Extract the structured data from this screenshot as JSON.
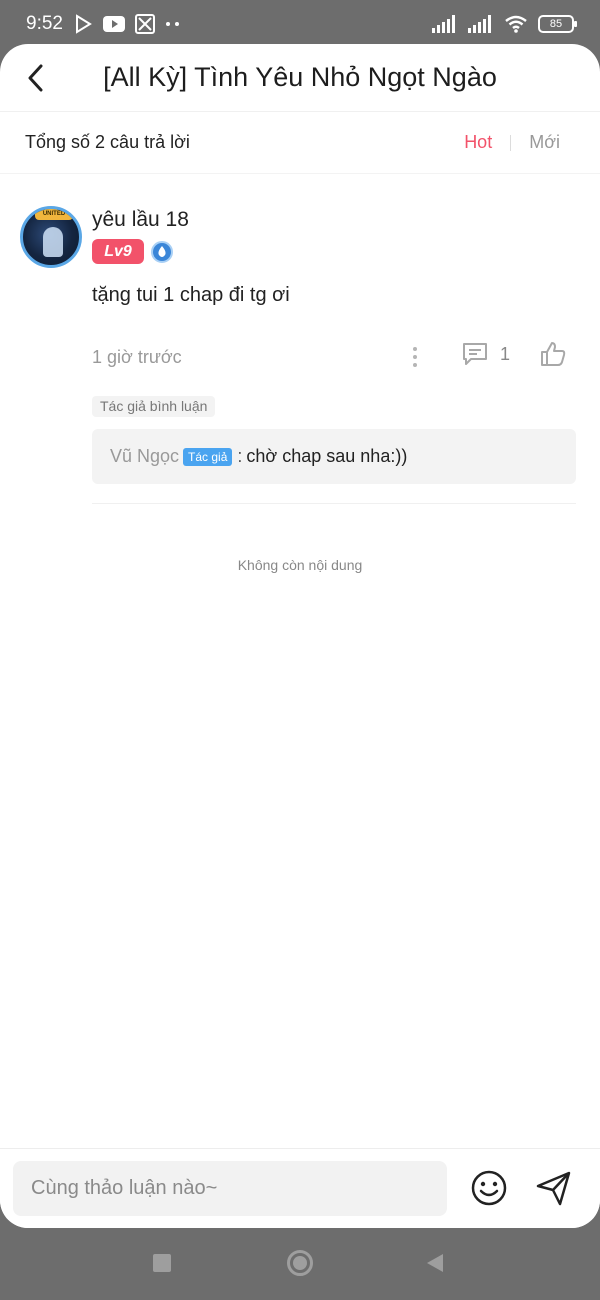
{
  "status_bar": {
    "time": "9:52",
    "battery": "85",
    "icons": [
      "play-store-icon",
      "youtube-icon",
      "app-icon",
      "more-notifications-icon",
      "signal-icon",
      "signal-icon",
      "wifi-icon",
      "battery-icon"
    ]
  },
  "header": {
    "title": "[All Kỳ] Tình Yêu Nhỏ Ngọt Ngào",
    "back_icon": "chevron-left-icon"
  },
  "summary": {
    "total_text": "Tổng số 2 câu trả lời",
    "sort_hot": "Hot",
    "sort_new": "Mới",
    "active_sort": "Hot",
    "accent_color": "#f2526a"
  },
  "comment": {
    "username": "yêu lầu 18",
    "avatar_badge_text": "UNITED",
    "level": "Lv9",
    "text": "tặng tui 1 chap đi tg ơi",
    "time": "1 giờ trước",
    "reply_count": "1",
    "author_tag": "Tác giả bình luận",
    "reply": {
      "user": "Vũ Ngọc",
      "author_chip": "Tác giả",
      "separator": ":",
      "text": "chờ chap sau nha:))"
    }
  },
  "footer_note": "Không còn nội dung",
  "input_bar": {
    "placeholder": "Cùng thảo luận nào~",
    "emoji_icon": "smiley-icon",
    "send_icon": "send-icon"
  },
  "nav_bar": {
    "icons": [
      "recent-apps-icon",
      "home-icon",
      "back-icon"
    ]
  }
}
